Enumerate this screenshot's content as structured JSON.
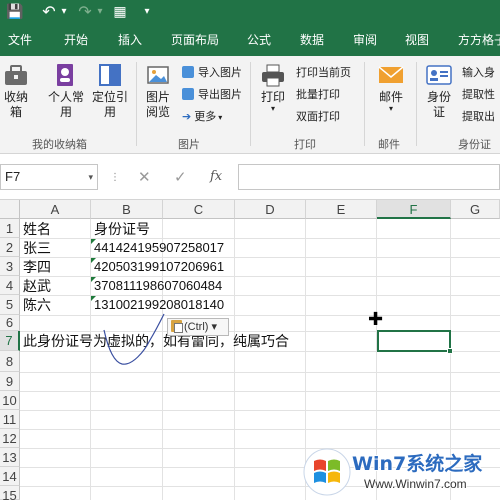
{
  "quick_access": {
    "save": "💾",
    "undo": "↶",
    "redo": "↷",
    "form": "▦",
    "more": "▾"
  },
  "menu": {
    "tabs": [
      "文件",
      "开始",
      "插入",
      "页面布局",
      "公式",
      "数据",
      "审阅",
      "视图",
      "方方格子"
    ]
  },
  "ribbon": {
    "groups": [
      {
        "label": "我的收纳箱"
      },
      {
        "label": "图片"
      },
      {
        "label": "打印"
      },
      {
        "label": "邮件"
      },
      {
        "label": "身份证"
      }
    ],
    "buttons": {
      "storage": "收纳箱",
      "personal_common": "个人常用",
      "locate_ref": "定位引用",
      "pic_view": "图片阅览",
      "import_pic": "导入图片",
      "export_pic": "导出图片",
      "more": "更多",
      "print": "打印",
      "print_current": "打印当前页",
      "batch_print": "批量打印",
      "duplex_print": "双面打印",
      "mail": "邮件",
      "id_card": "身份证",
      "input_id": "输入身",
      "extract1": "提取性",
      "extract2": "提取出"
    }
  },
  "formula_bar": {
    "name_box": "F7",
    "cancel": "✕",
    "confirm": "✓",
    "fx": "fx",
    "content": ""
  },
  "sheet": {
    "columns": [
      "A",
      "B",
      "C",
      "D",
      "E",
      "F",
      "G"
    ],
    "selected_column": "F",
    "rows": [
      "1",
      "2",
      "3",
      "4",
      "5",
      "6",
      "7",
      "8",
      "9",
      "10",
      "11",
      "12",
      "13",
      "14",
      "15"
    ],
    "selected_row": "7",
    "header_name": "姓名",
    "header_id": "身份证号",
    "records": [
      {
        "name": "张三",
        "id": "441424195907258017"
      },
      {
        "name": "李四",
        "id": "420503199107206961"
      },
      {
        "name": "赵武",
        "id": "370811198607060484"
      },
      {
        "name": "陈六",
        "id": "131002199208018140"
      }
    ],
    "note": "此身份证号为虚拟的，如有雷同，纯属巧合",
    "paste_options": "(Ctrl) ▾",
    "active_cell": "F7"
  },
  "watermark": {
    "brand": "Win7系统之家",
    "url": "Www.Winwin7.com"
  },
  "colors": {
    "accent": "#217346",
    "ribbon_bg": "#f3f3f3"
  }
}
